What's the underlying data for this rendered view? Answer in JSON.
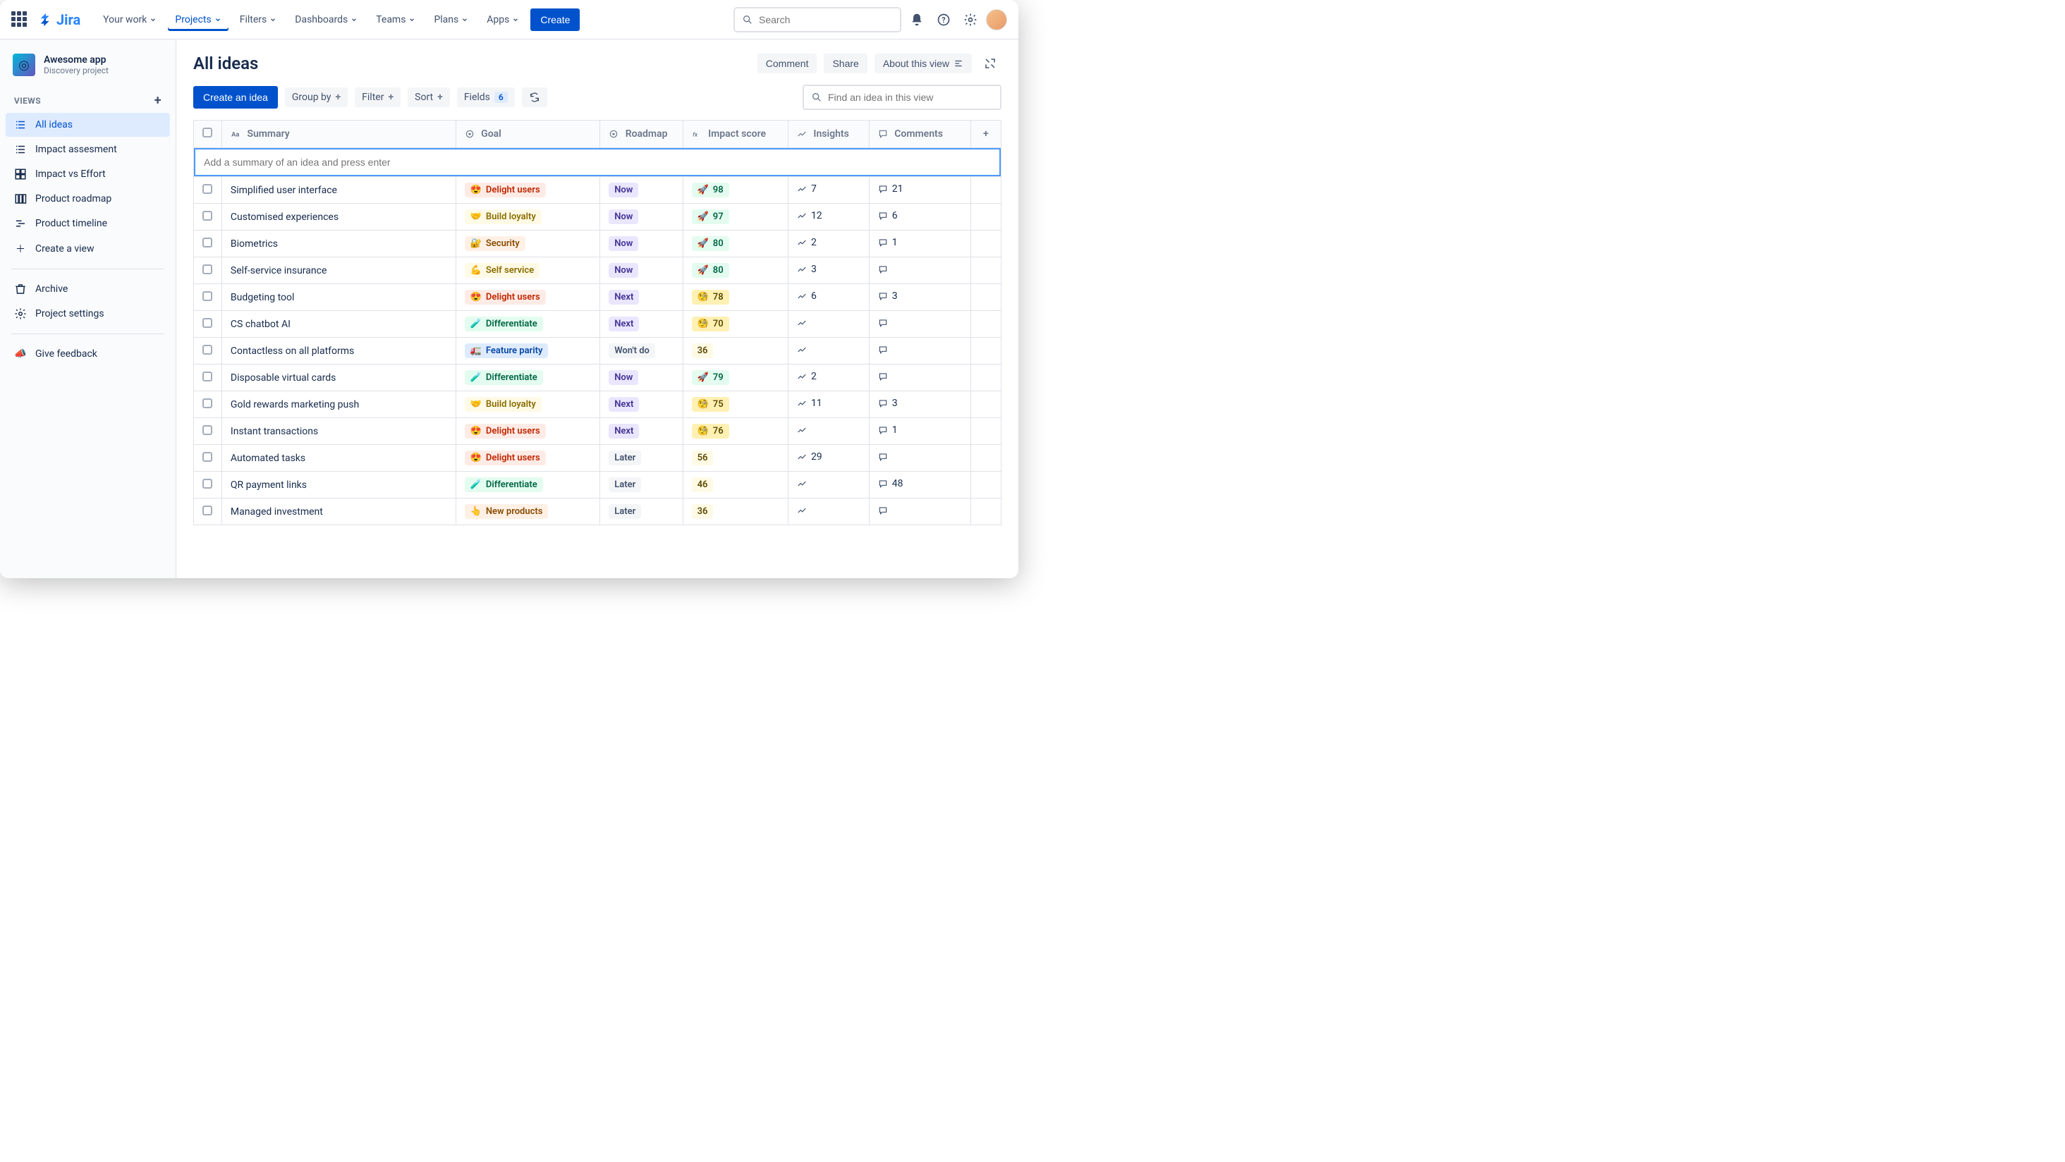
{
  "topnav": {
    "logo_text": "Jira",
    "items": [
      "Your work",
      "Projects",
      "Filters",
      "Dashboards",
      "Teams",
      "Plans",
      "Apps"
    ],
    "active_index": 1,
    "create": "Create",
    "search_placeholder": "Search"
  },
  "sidebar": {
    "project_name": "Awesome app",
    "project_sub": "Discovery project",
    "views_label": "VIEWS",
    "views": [
      {
        "label": "All ideas",
        "icon": "list"
      },
      {
        "label": "Impact assesment",
        "icon": "list"
      },
      {
        "label": "Impact vs Effort",
        "icon": "grid"
      },
      {
        "label": "Product roadmap",
        "icon": "columns"
      },
      {
        "label": "Product timeline",
        "icon": "timeline"
      }
    ],
    "selected_view": 0,
    "create_view": "Create a view",
    "bottom": [
      {
        "label": "Archive",
        "icon": "trash"
      },
      {
        "label": "Project settings",
        "icon": "gear"
      }
    ],
    "feedback": "Give feedback"
  },
  "view": {
    "title": "All ideas",
    "comment_btn": "Comment",
    "share_btn": "Share",
    "about_btn": "About this view",
    "create_idea": "Create an idea",
    "group_by": "Group by",
    "filter": "Filter",
    "sort": "Sort",
    "fields": "Fields",
    "fields_count": "6",
    "find_placeholder": "Find an idea in this view",
    "new_row_placeholder": "Add a summary of an idea and press enter"
  },
  "columns": {
    "summary": "Summary",
    "goal": "Goal",
    "roadmap": "Roadmap",
    "impact": "Impact score",
    "insights": "Insights",
    "comments": "Comments"
  },
  "goals": {
    "delight": {
      "label": "Delight users",
      "emoji": "😍",
      "cls": "goal-delight"
    },
    "loyalty": {
      "label": "Build loyalty",
      "emoji": "🤝",
      "cls": "goal-loyalty"
    },
    "security": {
      "label": "Security",
      "emoji": "🔐",
      "cls": "goal-security"
    },
    "selfservice": {
      "label": "Self service",
      "emoji": "💪",
      "cls": "goal-selfservice"
    },
    "differentiate": {
      "label": "Differentiate",
      "emoji": "🧪",
      "cls": "goal-differentiate"
    },
    "parity": {
      "label": "Feature parity",
      "emoji": "🚛",
      "cls": "goal-parity"
    },
    "newprod": {
      "label": "New products",
      "emoji": "👆",
      "cls": "goal-newprod"
    }
  },
  "roadmap": {
    "now": {
      "label": "Now",
      "cls": "rm-now"
    },
    "next": {
      "label": "Next",
      "cls": "rm-next"
    },
    "later": {
      "label": "Later",
      "cls": "rm-later"
    },
    "wontdo": {
      "label": "Won't do",
      "cls": "rm-wontdo"
    }
  },
  "rows": [
    {
      "summary": "Simplified user interface",
      "goal": "delight",
      "roadmap": "now",
      "score": 98,
      "score_tier": "hi",
      "insights": 7,
      "comments": 21
    },
    {
      "summary": "Customised experiences",
      "goal": "loyalty",
      "roadmap": "now",
      "score": 97,
      "score_tier": "hi",
      "insights": 12,
      "comments": 6
    },
    {
      "summary": "Biometrics",
      "goal": "security",
      "roadmap": "now",
      "score": 80,
      "score_tier": "hi",
      "insights": 2,
      "comments": 1
    },
    {
      "summary": "Self-service insurance",
      "goal": "selfservice",
      "roadmap": "now",
      "score": 80,
      "score_tier": "hi",
      "insights": 3,
      "comments": null
    },
    {
      "summary": "Budgeting tool",
      "goal": "delight",
      "roadmap": "next",
      "score": 78,
      "score_tier": "mid",
      "insights": 6,
      "comments": 3
    },
    {
      "summary": "CS chatbot AI",
      "goal": "differentiate",
      "roadmap": "next",
      "score": 70,
      "score_tier": "mid",
      "insights": null,
      "comments": null
    },
    {
      "summary": "Contactless on all platforms",
      "goal": "parity",
      "roadmap": "wontdo",
      "score": 36,
      "score_tier": "low",
      "insights": null,
      "comments": null
    },
    {
      "summary": "Disposable virtual cards",
      "goal": "differentiate",
      "roadmap": "now",
      "score": 79,
      "score_tier": "hi",
      "insights": 2,
      "comments": null
    },
    {
      "summary": "Gold rewards marketing push",
      "goal": "loyalty",
      "roadmap": "next",
      "score": 75,
      "score_tier": "mid",
      "insights": 11,
      "comments": 3
    },
    {
      "summary": "Instant transactions",
      "goal": "delight",
      "roadmap": "next",
      "score": 76,
      "score_tier": "mid",
      "insights": null,
      "comments": 1
    },
    {
      "summary": "Automated tasks",
      "goal": "delight",
      "roadmap": "later",
      "score": 56,
      "score_tier": "low",
      "insights": 29,
      "comments": null
    },
    {
      "summary": "QR payment links",
      "goal": "differentiate",
      "roadmap": "later",
      "score": 46,
      "score_tier": "low",
      "insights": null,
      "comments": 48
    },
    {
      "summary": "Managed investment",
      "goal": "newprod",
      "roadmap": "later",
      "score": 36,
      "score_tier": "low",
      "insights": null,
      "comments": null
    }
  ]
}
